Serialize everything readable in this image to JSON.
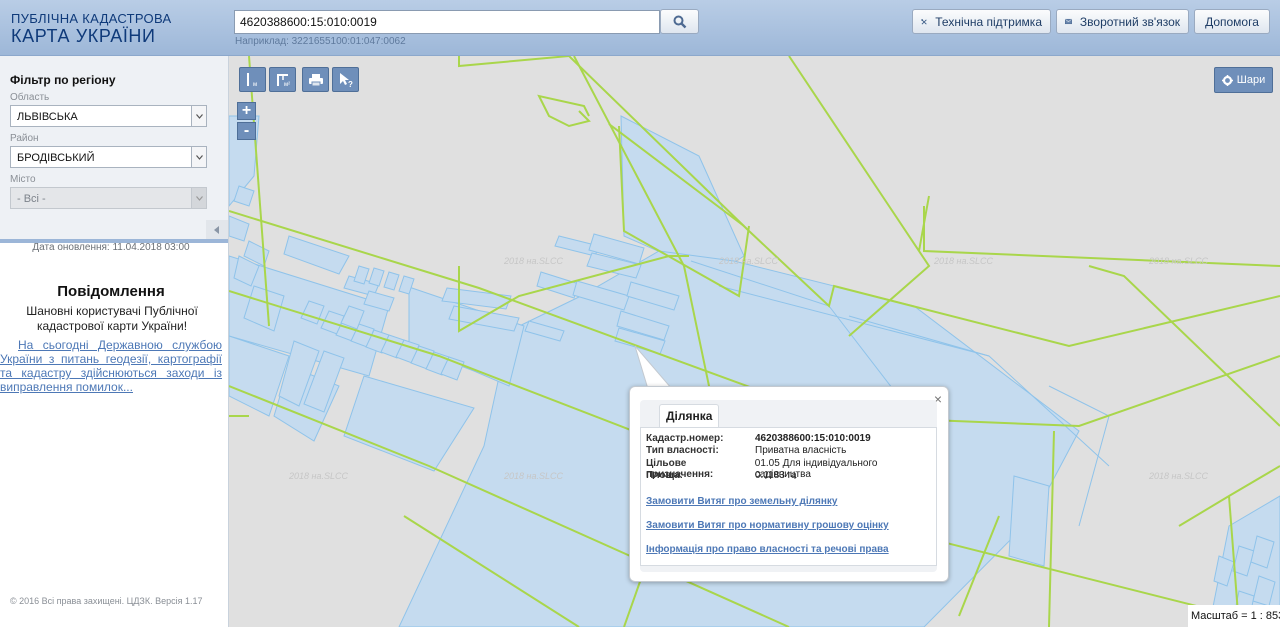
{
  "header": {
    "logo_line1": "ПУБЛІЧНА КАДАСТРОВА",
    "logo_line2": "КАРТА УКРАЇНИ",
    "search_value": "4620388600:15:010:0019",
    "search_hint": "Наприклад: 3221655100:01:047:0062",
    "support_label": "Технічна підтримка",
    "feedback_label": "Зворотний зв'язок",
    "help_label": "Допомога"
  },
  "sidebar": {
    "filter_title": "Фільтр по регіону",
    "region_label": "Область",
    "region_value": "ЛЬВІВСЬКА",
    "district_label": "Район",
    "district_value": "БРОДІВСЬКИЙ",
    "city_label": "Місто",
    "city_value": "- Всі -",
    "update_date": "Дата оновлення: 11.04.2018 03:00",
    "message_title": "Повідомлення",
    "message_body": "Шановні користувачі Публічної кадастрової карти України!",
    "message_link": "На сьогодні Державною службою України з питань геодезії, картографії та кадастру здійснюються заходи із виправлення помилок...",
    "copyright": "© 2016 Всі права захищені. ЦДЗК. Версія 1.17"
  },
  "map": {
    "watermark": "2018 на.SLCC",
    "layers_label": "Шари",
    "scale_text": "Масштаб = 1 : 8531",
    "zoom_in": "+",
    "zoom_out": "-"
  },
  "popup": {
    "tab_label": "Ділянка",
    "rows": [
      {
        "key": "Кадастр.номер:",
        "value": "4620388600:15:010:0019"
      },
      {
        "key": "Тип власності:",
        "value": "Приватна власність"
      },
      {
        "key": "Цільове призначення:",
        "value": "01.05 Для індивідуального садівництва"
      },
      {
        "key": "Площа:",
        "value": "0.1183 га"
      }
    ],
    "links": [
      "Замовити Витяг про земельну ділянку",
      "Замовити Витяг про нормативну грошову оцінку",
      "Інформація про право власності та речові права"
    ],
    "close_symbol": "×"
  },
  "colors": {
    "header_bg": "#a9c1e0",
    "map_bg": "#e0e0e0",
    "parcel_fill": "#c5dbef",
    "parcel_stroke": "#8fc3ea",
    "boundary_line": "#a9d64b",
    "button_blue": "#6f8fba",
    "link": "#4d78b6"
  }
}
